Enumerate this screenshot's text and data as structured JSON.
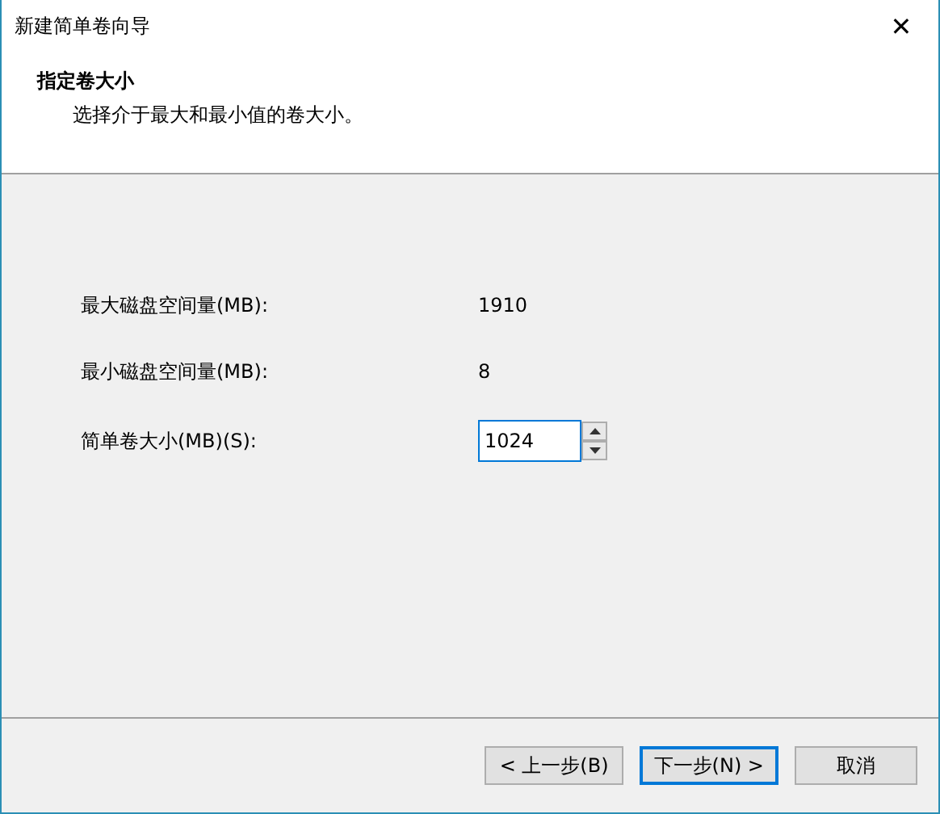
{
  "window": {
    "title": "新建简单卷向导",
    "close": "✕"
  },
  "header": {
    "title": "指定卷大小",
    "subtitle": "选择介于最大和最小值的卷大小。"
  },
  "fields": [
    {
      "kind": "text",
      "label": "最大磁盘空间量(MB):",
      "value": "1910"
    },
    {
      "kind": "text",
      "label": "最小磁盘空间量(MB):",
      "value": "8"
    },
    {
      "kind": "spin",
      "label": "简单卷大小(MB)(S):",
      "value": "1024",
      "focused": true
    }
  ],
  "buttons": [
    {
      "label": "< 上一步(B)",
      "default": false
    },
    {
      "label": "下一步(N) >",
      "default": true
    },
    {
      "label": "取消",
      "default": false
    }
  ]
}
